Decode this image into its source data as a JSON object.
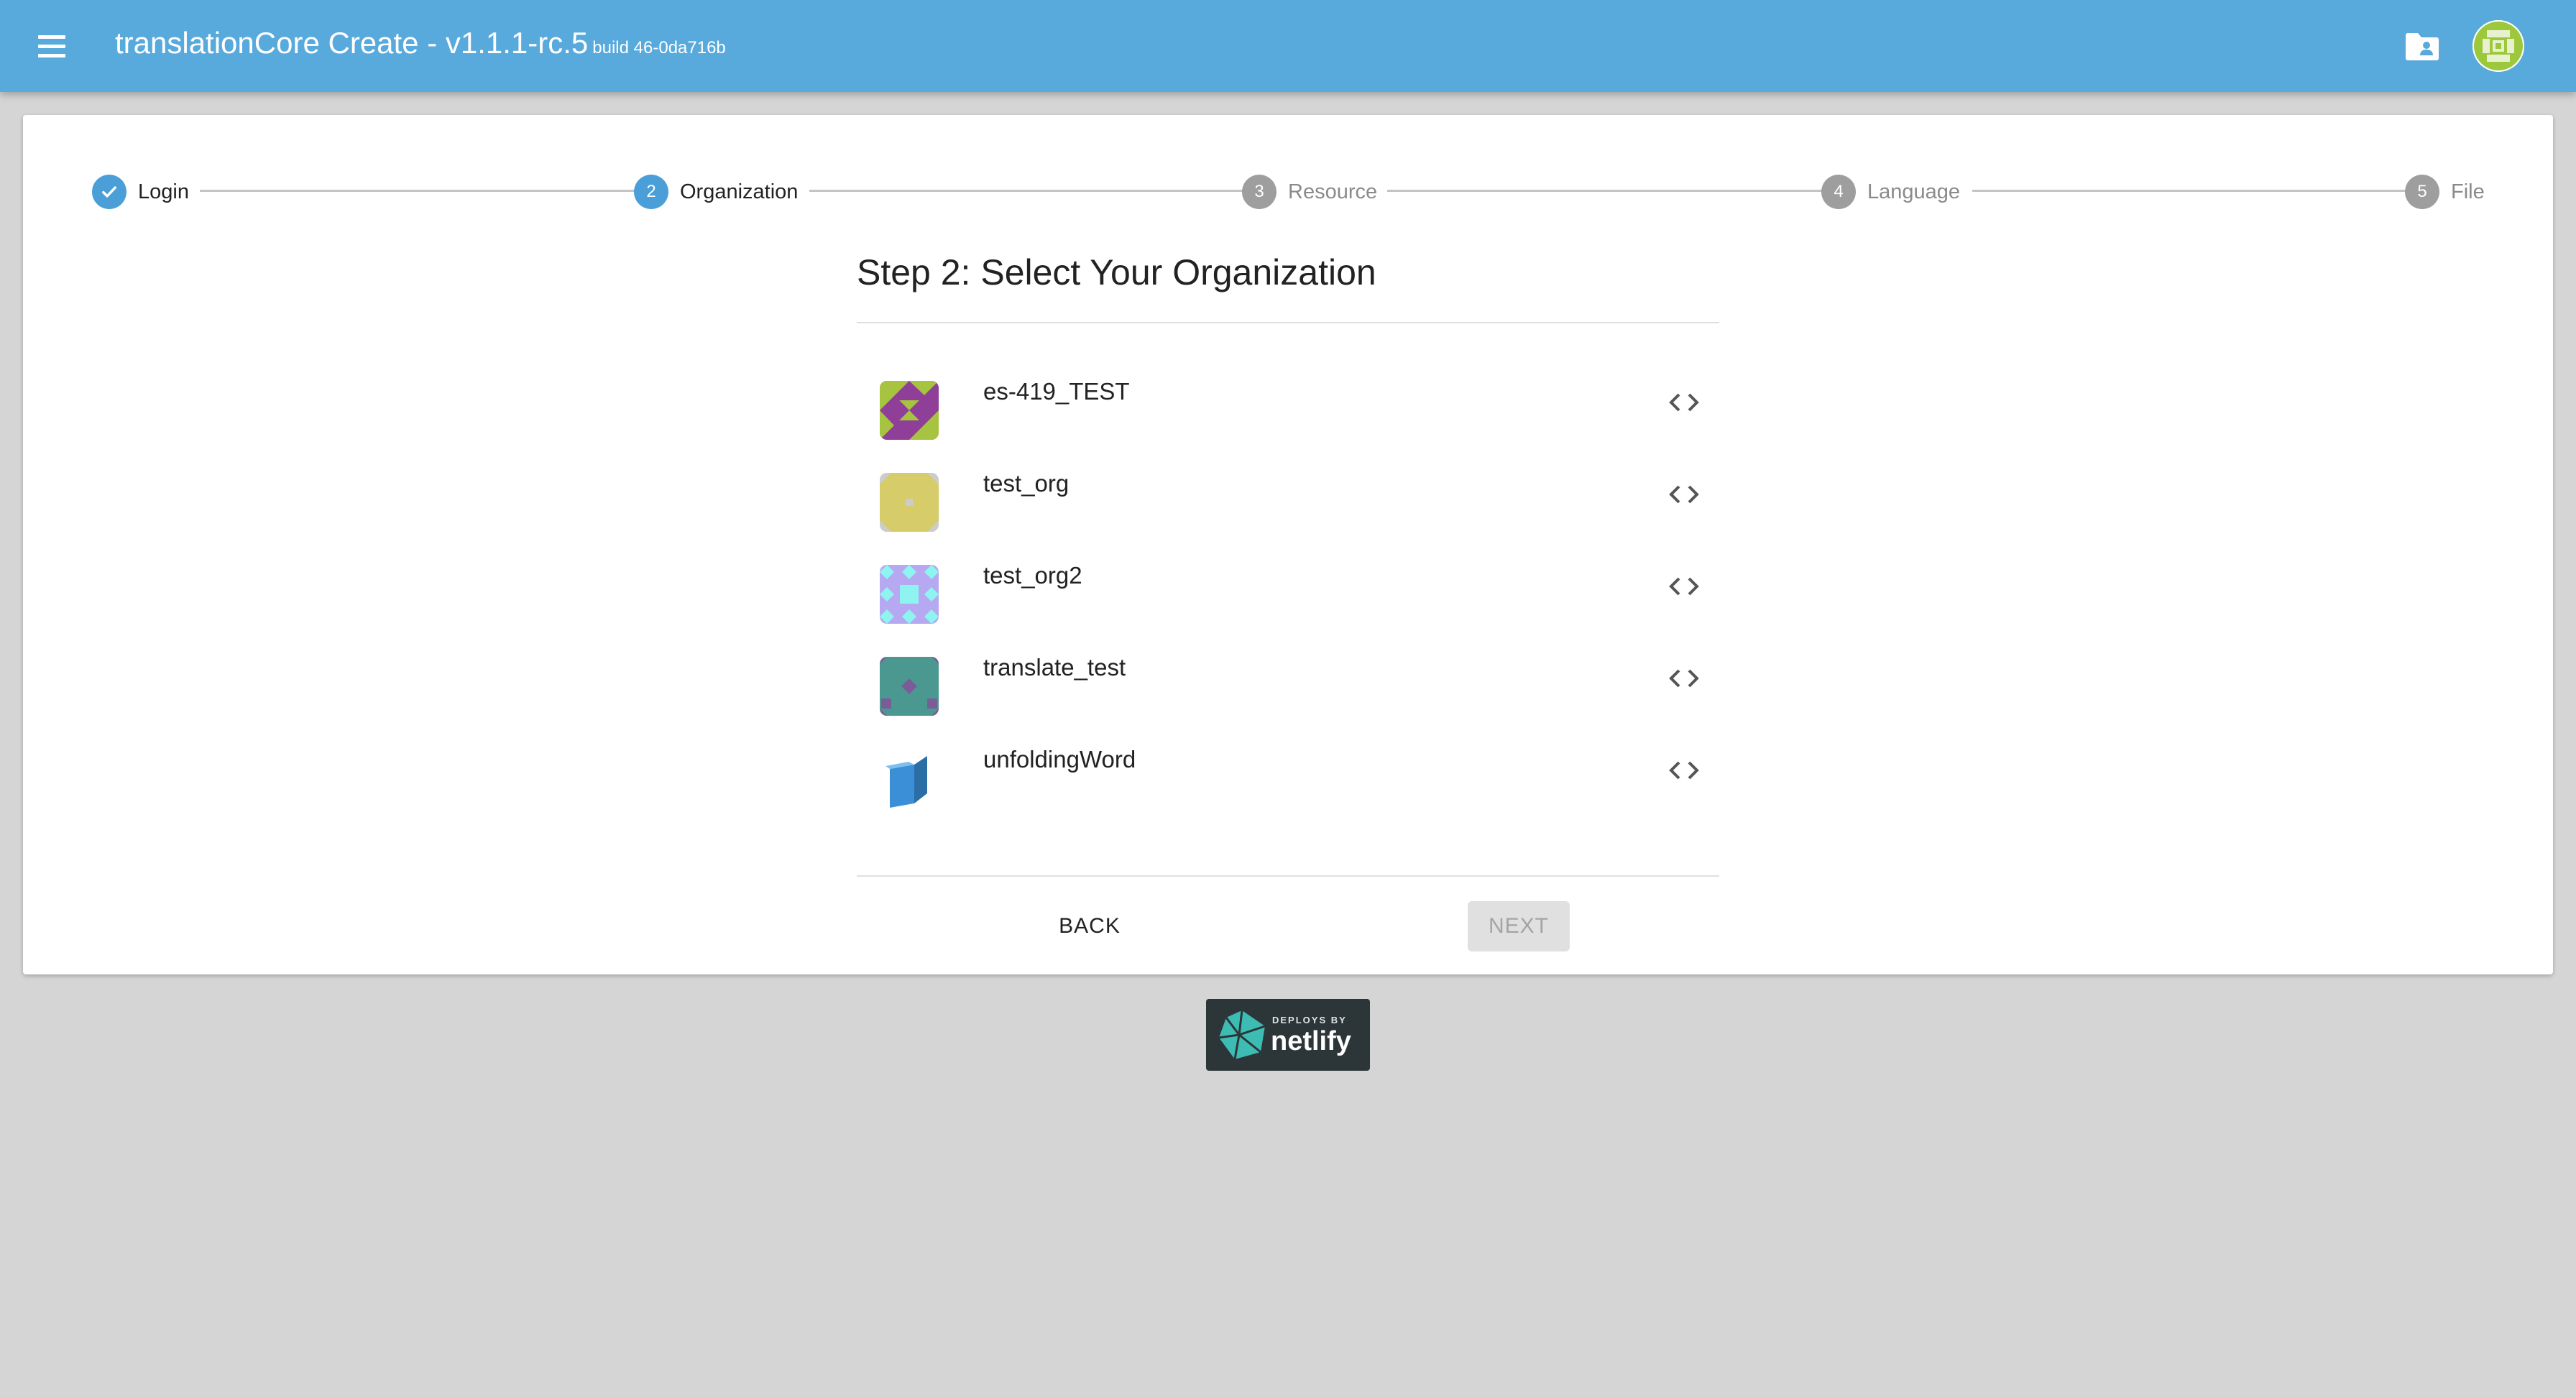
{
  "app": {
    "title": "translationCore Create - v1.1.1-rc.5",
    "build": "build 46-0da716b",
    "accent_color": "#58aadd"
  },
  "header": {
    "menu_icon": "hamburger-menu-icon",
    "folder_icon": "folder-user-icon",
    "avatar_icon": "user-identicon"
  },
  "stepper": {
    "steps": [
      {
        "number": "1",
        "label": "Login",
        "state": "done"
      },
      {
        "number": "2",
        "label": "Organization",
        "state": "active"
      },
      {
        "number": "3",
        "label": "Resource",
        "state": "pending"
      },
      {
        "number": "4",
        "label": "Language",
        "state": "pending"
      },
      {
        "number": "5",
        "label": "File",
        "state": "pending"
      }
    ]
  },
  "main": {
    "heading": "Step 2: Select Your Organization",
    "organizations": [
      {
        "name": "es-419_TEST",
        "action_icon": "code-icon"
      },
      {
        "name": "test_org",
        "action_icon": "code-icon"
      },
      {
        "name": "test_org2",
        "action_icon": "code-icon"
      },
      {
        "name": "translate_test",
        "action_icon": "code-icon"
      },
      {
        "name": "unfoldingWord",
        "action_icon": "code-icon"
      }
    ],
    "back_label": "BACK",
    "next_label": "NEXT"
  },
  "footer": {
    "badge_small": "DEPLOYS BY",
    "badge_big": "netlify"
  }
}
